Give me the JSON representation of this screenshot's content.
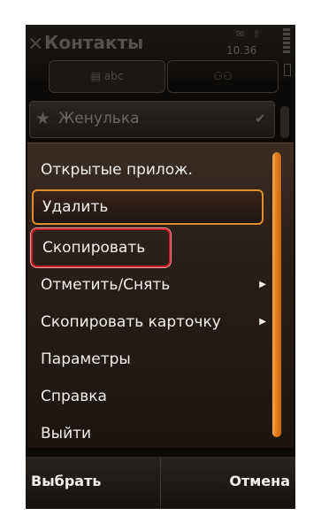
{
  "app": {
    "title": "Контакты",
    "time": "10.36"
  },
  "tabs": [
    {
      "label": "abc"
    },
    {
      "label": ""
    }
  ],
  "contact": {
    "name": "Женулька"
  },
  "menu": {
    "items": [
      {
        "label": "Открытые прилож.",
        "submenu": false
      },
      {
        "label": "Удалить",
        "submenu": false,
        "selected": true
      },
      {
        "label": "Скопировать",
        "submenu": false,
        "highlighted": true
      },
      {
        "label": "Отметить/Снять",
        "submenu": true
      },
      {
        "label": "Скопировать карточку",
        "submenu": true
      },
      {
        "label": "Параметры",
        "submenu": false
      },
      {
        "label": "Справка",
        "submenu": false
      },
      {
        "label": "Выйти",
        "submenu": false
      }
    ]
  },
  "softkeys": {
    "left": "Выбрать",
    "right": "Отмена"
  },
  "colors": {
    "accent_orange": "#e38d2a",
    "highlight_red": "#c91f2a"
  }
}
